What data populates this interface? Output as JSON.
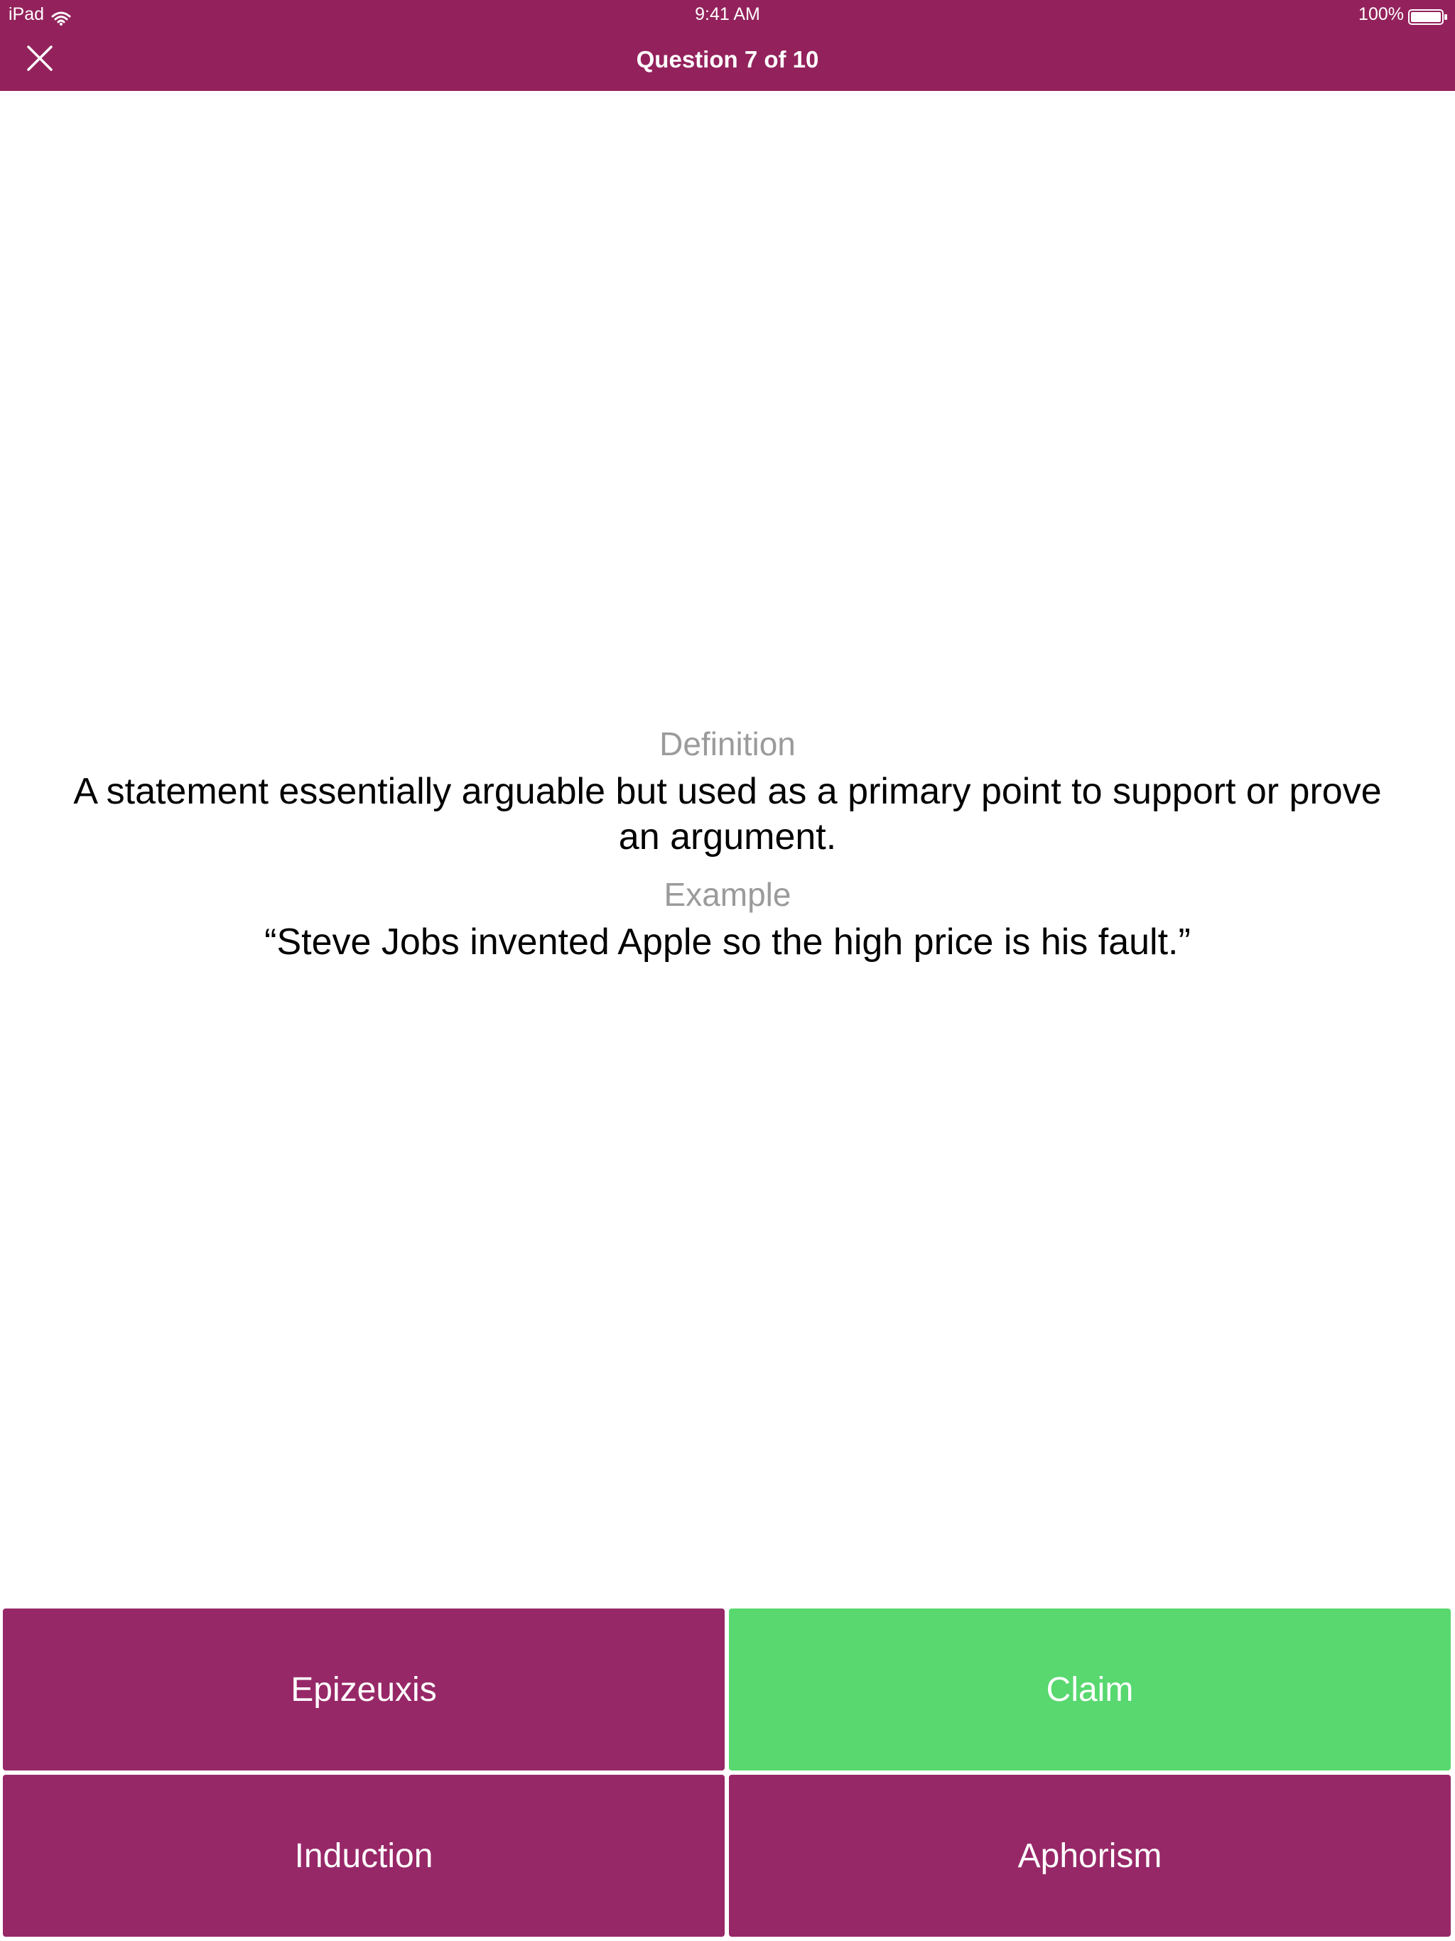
{
  "status_bar": {
    "device": "iPad",
    "time": "9:41 AM",
    "battery": "100%"
  },
  "nav": {
    "title": "Question 7 of 10",
    "close_icon": "close-icon"
  },
  "question": {
    "definition_label": "Definition",
    "definition_text": "A statement essentially arguable but used as a primary point to support or prove an argument.",
    "example_label": "Example",
    "example_text": "“Steve Jobs invented Apple so the high price is his fault.”"
  },
  "answers": [
    {
      "label": "Epizeuxis",
      "color": "#972868",
      "state": "default"
    },
    {
      "label": "Claim",
      "color": "#58d86f",
      "state": "correct"
    },
    {
      "label": "Induction",
      "color": "#972868",
      "state": "default"
    },
    {
      "label": "Aphorism",
      "color": "#972868",
      "state": "default"
    }
  ],
  "colors": {
    "header": "#93225c",
    "answer_default": "#972868",
    "answer_correct": "#58d86f",
    "label_gray": "#9b9b9b"
  }
}
